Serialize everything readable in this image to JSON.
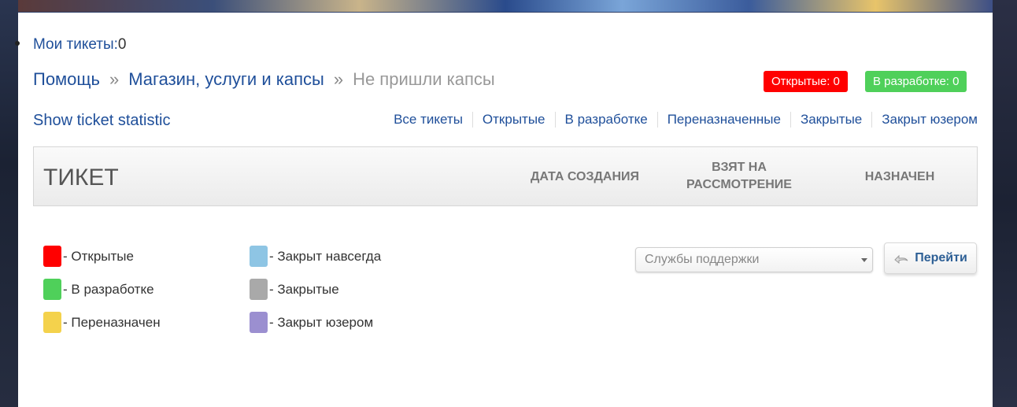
{
  "header": {
    "my_tickets_label": "Мои тикеты:",
    "my_tickets_count": "0"
  },
  "breadcrumb": {
    "items": [
      "Помощь",
      "Магазин, услуги и капсы"
    ],
    "separator": "»",
    "current": "Не пришли капсы"
  },
  "badges": {
    "open": "Открытые: 0",
    "in_dev": "В разработке: 0"
  },
  "stats_link": "Show ticket statistic",
  "filters": [
    "Все тикеты",
    "Открытые",
    "В разработке",
    "Переназначенные",
    "Закрытые",
    "Закрыт юзером"
  ],
  "table_header": {
    "ticket": "ТИКЕТ",
    "created": "ДАТА СОЗДАНИЯ",
    "taken": "ВЗЯТ НА РАССМОТРЕНИЕ",
    "assigned": "НАЗНАЧЕН"
  },
  "legend": [
    {
      "label": "- Открытые",
      "color": "#ff0000"
    },
    {
      "label": "- В разработке",
      "color": "#4fd05a"
    },
    {
      "label": "- Переназначен",
      "color": "#f4d24c"
    },
    {
      "label": "- Закрыт навсегда",
      "color": "#8ec5e4"
    },
    {
      "label": "- Закрытые",
      "color": "#a9a9a9"
    },
    {
      "label": "- Закрыт юзером",
      "color": "#9b8fd0"
    }
  ],
  "select": {
    "value": "Службы поддержки"
  },
  "go_button": {
    "label": "Перейти"
  },
  "icons": [
    "chevron-down-icon",
    "return-arrow-icon"
  ]
}
